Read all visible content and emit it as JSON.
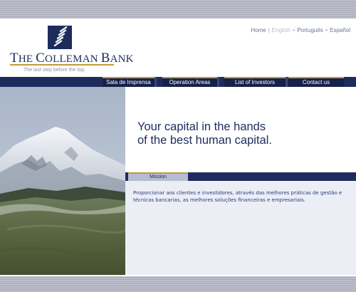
{
  "brand": {
    "name_prefix": "The",
    "name_main": "Colleman",
    "name_suffix": "Bank",
    "tagline": "The last step before the top.",
    "logo_icon": "stacked-bars-logo-icon",
    "colors": {
      "navy": "#1d2c5c",
      "gold": "#c49a3a"
    }
  },
  "languages": {
    "home": "Home",
    "separator": "|",
    "items": [
      "English",
      "Português",
      "Español"
    ],
    "active": "English",
    "dot": "•"
  },
  "nav": {
    "items": [
      "Sala de Imprensa",
      "Operation Areas",
      "List of Investors",
      "Contact us"
    ]
  },
  "hero": {
    "headline_line1": "Your capital in the hands",
    "headline_line2": "of the best human capital."
  },
  "mission": {
    "tab_label": "Mission",
    "text": "Proporcionar aos clientes e investidores, através das melhores práticas de gestão e técnicas bancarias, as melhores soluções financeiras e empresariais."
  }
}
